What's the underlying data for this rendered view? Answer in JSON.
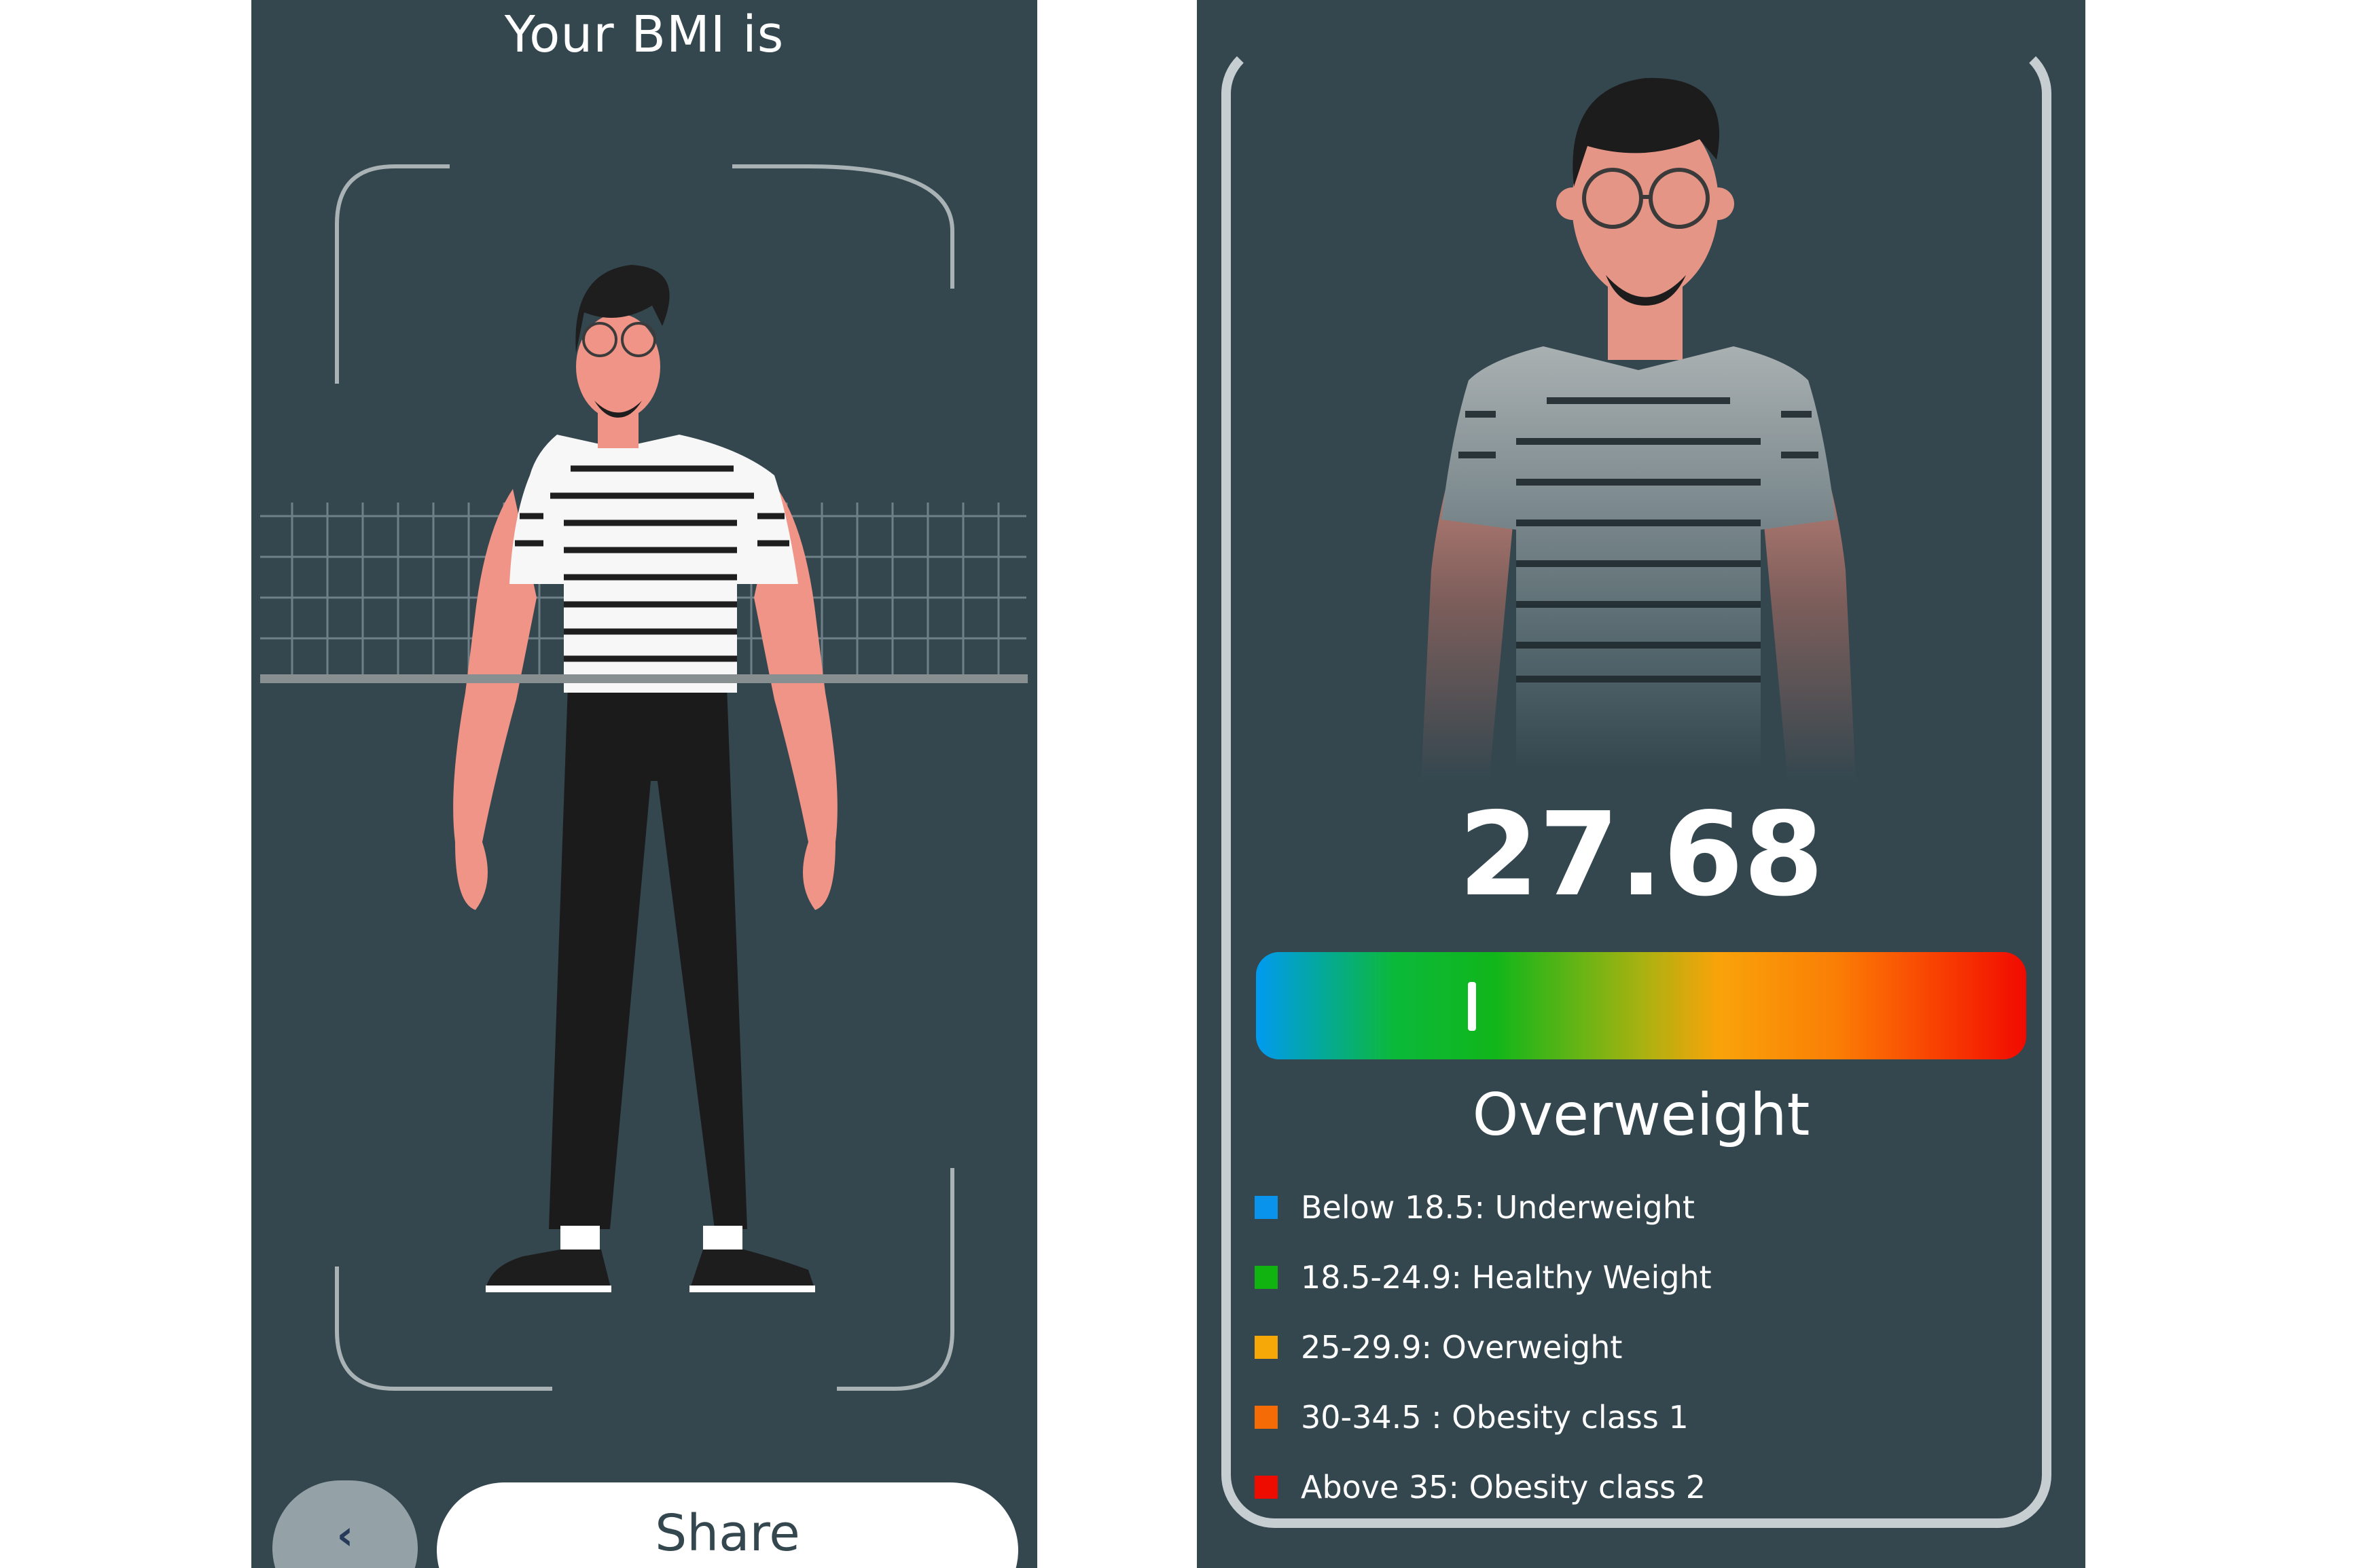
{
  "left_screen": {
    "title": "Your BMI is",
    "back_button": {
      "icon": "chevron-left-icon",
      "glyph": "‹"
    },
    "share_button": {
      "label": "Share"
    }
  },
  "right_screen": {
    "bmi_value": "27.68",
    "category": "Overweight",
    "gauge": {
      "marker_fraction": 0.28
    },
    "legend": [
      {
        "label": "Below 18.5: Underweight",
        "color": "#0a93ec"
      },
      {
        "label": "18.5-24.9: Healthy Weight",
        "color": "#10b30f"
      },
      {
        "label": "25-29.9: Overweight",
        "color": "#f6a809"
      },
      {
        "label": "30-34.5 : Obesity class 1",
        "color": "#f56c07"
      },
      {
        "label": "Above 35: Obesity class 2",
        "color": "#ee0c00"
      }
    ]
  }
}
